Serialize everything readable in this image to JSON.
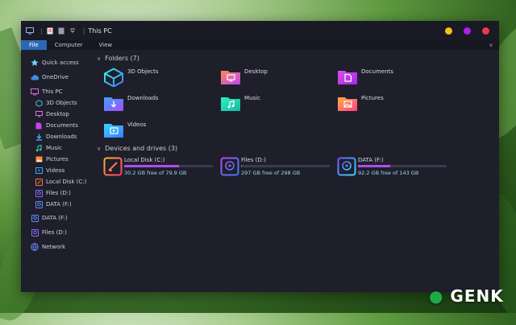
{
  "window": {
    "title": "This PC",
    "controls": {
      "minimize_color": "#f2c21b",
      "maximize_color": "#b11fe8",
      "close_color": "#ef3a4a"
    }
  },
  "ribbon": {
    "tabs": [
      "File",
      "Computer",
      "View"
    ],
    "active": "File",
    "expand_glyph": "v"
  },
  "sidebar": {
    "quick_access": "Quick access",
    "onedrive": "OneDrive",
    "this_pc": "This PC",
    "this_pc_children": [
      "3D Objects",
      "Desktop",
      "Documents",
      "Downloads",
      "Music",
      "Pictures",
      "Videos",
      "Local Disk (C:)",
      "Files (D:)",
      "DATA (F:)"
    ],
    "data_f": "DATA (F:)",
    "files_d": "Files (D:)",
    "network": "Network"
  },
  "folders_section": {
    "label": "Folders (7)"
  },
  "folders": [
    "3D Objects",
    "Desktop",
    "Documents",
    "Downloads",
    "Music",
    "Pictures",
    "Videos"
  ],
  "drives_section": {
    "label": "Devices and drives (3)"
  },
  "drives": [
    {
      "name": "Local Disk (C:)",
      "free": "30.2 GB free of 79.9 GB",
      "used_fraction": 0.62,
      "bar_color": "#b04ee8"
    },
    {
      "name": "Files (D:)",
      "free": "297 GB free of 298 GB",
      "used_fraction": 0.01,
      "bar_color": "#2e78d6"
    },
    {
      "name": "DATA (F:)",
      "free": "92.2 GB free of 143 GB",
      "used_fraction": 0.36,
      "bar_color": "#b04ee8"
    }
  ],
  "watermark": {
    "text": "GENK"
  }
}
